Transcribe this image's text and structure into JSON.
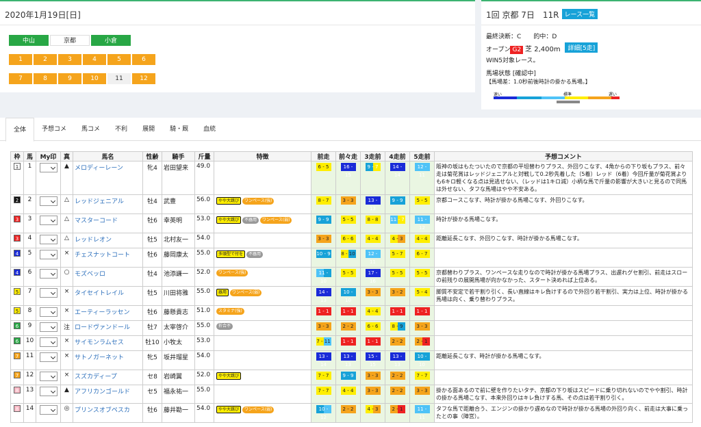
{
  "date": "2020年1月19日[日]",
  "venues": [
    {
      "label": "中山",
      "active": true
    },
    {
      "label": "京都",
      "active": false
    },
    {
      "label": "小倉",
      "active": true
    }
  ],
  "races_row1": [
    "1",
    "2",
    "3",
    "4",
    "5",
    "6"
  ],
  "races_row2": [
    "7",
    "8",
    "9",
    "10",
    "11",
    "12"
  ],
  "race": {
    "title": "1回 京都 7日　11R",
    "list_button": "レース一覧",
    "final": "最終決断：C",
    "hit": "的中：D",
    "class": "オープン",
    "grade": "G2",
    "course": "芝 2,400m",
    "detail_button": "詳細[5走]",
    "win5": "WIN5対象レース。",
    "track_state": "馬場状態 [確認中]",
    "track_note": "【馬場差：1.0秒前後時計の掛かる馬場。】",
    "scale_fast": "速い",
    "scale_std": "標準",
    "scale_slow": "遅い"
  },
  "tabs": [
    "全体",
    "予想コメ",
    "馬コメ",
    "不利",
    "展開",
    "騎・厩",
    "血統"
  ],
  "headers": [
    "枠",
    "馬",
    "My印",
    "真",
    "馬名",
    "性齢",
    "騎手",
    "斤量",
    "特徴",
    "前走",
    "前々走",
    "3走前",
    "4走前",
    "5走前",
    "予想コメント"
  ],
  "rows": [
    {
      "w": "1",
      "n": "1",
      "mark": "▲",
      "name": "メロディーレーン",
      "age": "牝4",
      "jockey": "岩田望来",
      "wt": "49.0",
      "tags": [],
      "p": [
        [
          "6",
          "5"
        ],
        [
          "16",
          "15"
        ],
        [
          "9",
          "7"
        ],
        [
          "14",
          "14"
        ],
        [
          "12",
          "11"
        ]
      ],
      "cm": "阪神の坂はもたついたので京都の平坦替わりプラス、外回りこなす、4角からの下り坂もプラス、前々走は菊花賞はレッドジェニアルと対戦して0.2秒先着した（5着）レッド（6着）今回斤量が菊花賞よりも6キロ軽くなる点は見逃せない、（レッドは1キロ減）小柄な馬で斤量の影響が大きいと見るので同馬は外せない、タフな馬場はやや不安ある。"
    },
    {
      "w": "2",
      "n": "2",
      "mark": "△",
      "name": "レッドジェニアル",
      "age": "牡4",
      "jockey": "武豊",
      "wt": "56.0",
      "tags": [
        "y:やや大跳び",
        "o:ワンペース(強)"
      ],
      "p": [
        [
          "8",
          "7"
        ],
        [
          "3",
          "3"
        ],
        [
          "13",
          "13"
        ],
        [
          "9",
          "9"
        ],
        [
          "5",
          "5"
        ]
      ],
      "cm": "京都コースこなす、時計が掛かる馬場こなす、外回りこなす。"
    },
    {
      "w": "3",
      "n": "3",
      "mark": "△",
      "name": "マスターコード",
      "age": "牡6",
      "jockey": "幸英明",
      "wt": "53.0",
      "tags": [
        "y:やや大跳び",
        "g:不器用",
        "o:ワンペース(弱)"
      ],
      "p": [
        [
          "9",
          "9"
        ],
        [
          "5",
          "5"
        ],
        [
          "8",
          "8"
        ],
        [
          "11",
          "7"
        ],
        [
          "11",
          "12"
        ]
      ],
      "cm": "時計が掛かる馬場こなす。"
    },
    {
      "w": "3",
      "n": "4",
      "mark": "△",
      "name": "レッドレオン",
      "age": "牡5",
      "jockey": "北村友一",
      "wt": "54.0",
      "tags": [],
      "p": [
        [
          "3",
          "3"
        ],
        [
          "6",
          "6"
        ],
        [
          "4",
          "4"
        ],
        [
          "4",
          "3"
        ],
        [
          "4",
          "4"
        ]
      ],
      "cm": "距離延長こなす、外回りこなす、時計が掛かる馬場こなす。"
    },
    {
      "w": "4",
      "n": "5",
      "mark": "×",
      "name": "チェスナットコート",
      "age": "牡6",
      "jockey": "藤岡康太",
      "wt": "55.0",
      "tags": [
        "y:多頭型で付を",
        "g:不器用"
      ],
      "p": [
        [
          "10",
          "9"
        ],
        [
          "8",
          "10"
        ],
        [
          "12",
          "11"
        ],
        [
          "5",
          "7"
        ],
        [
          "6",
          "7"
        ]
      ],
      "cm": ""
    },
    {
      "w": "4",
      "n": "6",
      "mark": "○",
      "name": "モズベッロ",
      "age": "牡4",
      "jockey": "池添謙一",
      "wt": "52.0",
      "tags": [
        "o:ワンペース(強)"
      ],
      "p": [
        [
          "11",
          "10"
        ],
        [
          "5",
          "5"
        ],
        [
          "17",
          "16"
        ],
        [
          "5",
          "5"
        ],
        [
          "5",
          "5"
        ]
      ],
      "cm": "京都替わりプラス、ワンペースな走りなので時計が掛かる馬場プラス、出遅れグセ割引、前走はスローの前残りの展開馬場が向かなかった、スタート決めれば上位ある。"
    },
    {
      "w": "5",
      "n": "7",
      "mark": "×",
      "name": "タイセイトレイル",
      "age": "牡5",
      "jockey": "川田将雅",
      "wt": "55.0",
      "tags": [
        "y:器用",
        "o:ワンペース(弱)"
      ],
      "p": [
        [
          "14",
          "13"
        ],
        [
          "10",
          "10"
        ],
        [
          "3",
          "3"
        ],
        [
          "3",
          "2"
        ],
        [
          "5",
          "4"
        ]
      ],
      "cm": "脚質不安定で若干割り引く、長い直線はキレ負けするので外回り若干割引、実力は上位、時計が掛かる馬場は向く、乗り替わりプラス。"
    },
    {
      "w": "5",
      "n": "8",
      "mark": "×",
      "name": "エーティーラッセン",
      "age": "牡6",
      "jockey": "藤懸貴志",
      "wt": "51.0",
      "tags": [
        "o:スタミナ(強)"
      ],
      "p": [
        [
          "1",
          "1"
        ],
        [
          "1",
          "1"
        ],
        [
          "4",
          "4"
        ],
        [
          "1",
          "1"
        ],
        [
          "1",
          "1"
        ]
      ],
      "cm": ""
    },
    {
      "w": "6",
      "n": "9",
      "mark": "注",
      "name": "ロードヴァンドール",
      "age": "牡7",
      "jockey": "太宰啓介",
      "wt": "55.0",
      "tags": [
        "g:折合不"
      ],
      "p": [
        [
          "3",
          "3"
        ],
        [
          "2",
          "2"
        ],
        [
          "6",
          "6"
        ],
        [
          "8",
          "9"
        ],
        [
          "3",
          "3"
        ]
      ],
      "cm": ""
    },
    {
      "w": "6",
      "n": "10",
      "mark": "×",
      "name": "サイモンラムセス",
      "age": "牡10",
      "jockey": "小牧太",
      "wt": "53.0",
      "tags": [],
      "p": [
        [
          "7",
          "11"
        ],
        [
          "1",
          "1"
        ],
        [
          "1",
          "1"
        ],
        [
          "2",
          "2"
        ],
        [
          "2",
          "1"
        ]
      ],
      "cm": ""
    },
    {
      "w": "7",
      "n": "11",
      "mark": "×",
      "name": "サトノガーネット",
      "age": "牝5",
      "jockey": "坂井瑠星",
      "wt": "54.0",
      "tags": [],
      "p": [
        [
          "13",
          "14"
        ],
        [
          "13",
          "13"
        ],
        [
          "15",
          "15"
        ],
        [
          "13",
          "13"
        ],
        [
          "10",
          "10"
        ]
      ],
      "cm": "距離延長こなす、時計が掛かる馬場こなす。"
    },
    {
      "w": "7",
      "n": "12",
      "mark": "×",
      "name": "スズカディープ",
      "age": "セ8",
      "jockey": "岩崎翼",
      "wt": "52.0",
      "tags": [
        "y:やや大跳び"
      ],
      "p": [
        [
          "7",
          "7"
        ],
        [
          "9",
          "9"
        ],
        [
          "3",
          "3"
        ],
        [
          "2",
          "2"
        ],
        [
          "7",
          "7"
        ]
      ],
      "cm": ""
    },
    {
      "w": "8",
      "n": "13",
      "mark": "▲",
      "name": "アフリカンゴールド",
      "age": "セ5",
      "jockey": "福永祐一",
      "wt": "55.0",
      "tags": [],
      "p": [
        [
          "7",
          "7"
        ],
        [
          "4",
          "4"
        ],
        [
          "3",
          "3"
        ],
        [
          "2",
          "2"
        ],
        [
          "3",
          "3"
        ]
      ],
      "cm": "掛かる面あるので前に壁を作りたいタチ、京都の下り坂はスピードに乗り切れないのでやや割引、時計の掛かる馬場こなす、本来外回りはキレ負けする馬、その点は若干割り引く。"
    },
    {
      "w": "8",
      "n": "14",
      "mark": "◎",
      "name": "プリンスオブペスカ",
      "age": "牡6",
      "jockey": "藤井勘一",
      "wt": "54.0",
      "tags": [
        "y:やや大跳び",
        "o:ワンペース(弱)"
      ],
      "p": [
        [
          "10",
          "12"
        ],
        [
          "2",
          "2"
        ],
        [
          "4",
          "3"
        ],
        [
          "2",
          "1"
        ],
        [
          "11",
          "11"
        ]
      ],
      "cm": "タフな馬で距離合う、エンジンの掛かり遅めなので時計が掛かる馬場の外回り向く、前走は大事に乗ったとの事（陣営）。"
    }
  ],
  "colors": {
    "accent": "#3cb371",
    "orange": "#f5a41c",
    "blue": "#17a2d8"
  }
}
